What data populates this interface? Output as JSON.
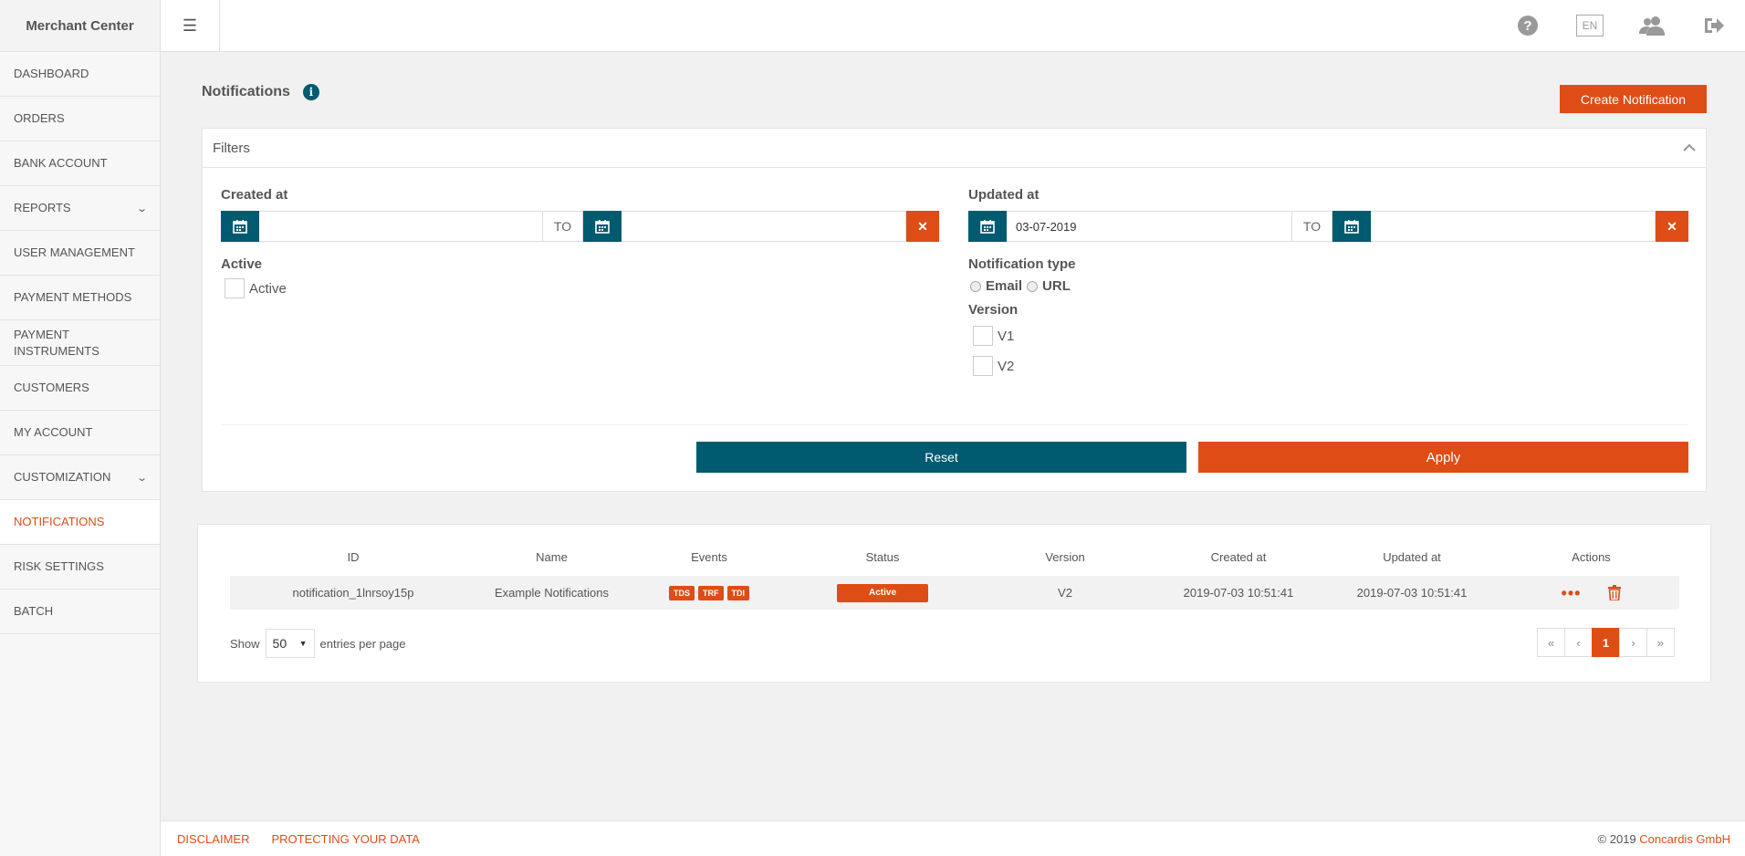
{
  "sidebar": {
    "brand": "Merchant Center",
    "items": [
      {
        "label": "DASHBOARD"
      },
      {
        "label": "ORDERS"
      },
      {
        "label": "BANK ACCOUNT"
      },
      {
        "label": "REPORTS"
      },
      {
        "label": "USER MANAGEMENT"
      },
      {
        "label": "PAYMENT METHODS"
      },
      {
        "label": "PAYMENT INSTRUMENTS"
      },
      {
        "label": "CUSTOMERS"
      },
      {
        "label": "MY ACCOUNT"
      },
      {
        "label": "CUSTOMIZATION"
      },
      {
        "label": "NOTIFICATIONS"
      },
      {
        "label": "RISK SETTINGS"
      },
      {
        "label": "BATCH"
      }
    ],
    "active_item": "NOTIFICATIONS"
  },
  "topbar": {
    "menu_icon": "hamburger-icon",
    "icons": [
      "help-icon",
      "language-icon",
      "users-icon",
      "logout-icon"
    ],
    "language": "EN"
  },
  "page": {
    "title": "Notifications",
    "info_glyph": "i",
    "create_label": "Create Notification"
  },
  "filters": {
    "title": "Filters",
    "created_at": {
      "label": "Created at",
      "from": "",
      "to_label": "TO",
      "to": ""
    },
    "updated_at": {
      "label": "Updated at",
      "from": "03-07-2019",
      "to_label": "TO",
      "to": ""
    },
    "active": {
      "label": "Active",
      "option": "Active"
    },
    "notification_type": {
      "label": "Notification type",
      "options": [
        "Email",
        "URL"
      ]
    },
    "version": {
      "label": "Version",
      "options": [
        "V1",
        "V2"
      ]
    },
    "reset_label": "Reset",
    "apply_label": "Apply"
  },
  "table": {
    "columns": [
      "ID",
      "Name",
      "Events",
      "Status",
      "Version",
      "Created at",
      "Updated at",
      "Actions"
    ],
    "rows": [
      {
        "id": "notification_1lnrsoy15p",
        "name": "Example Notifications",
        "events": [
          "TDS",
          "TRF",
          "TDI"
        ],
        "status": "Active",
        "version": "V2",
        "created_at": "2019-07-03 10:51:41",
        "updated_at": "2019-07-03 10:51:41"
      }
    ],
    "show_label": "Show",
    "page_size": "50",
    "entries_label": "entries per page",
    "pager": [
      "«",
      "‹",
      "1",
      "›",
      "»"
    ],
    "current_page": "1"
  },
  "footer": {
    "disclaimer": "DISCLAIMER",
    "protecting": "PROTECTING YOUR DATA",
    "copyright_prefix": "© 2019",
    "copyright_brand": "Concardis GmbH"
  },
  "colors": {
    "accent_orange": "#de4d16",
    "accent_teal": "#005a70"
  }
}
